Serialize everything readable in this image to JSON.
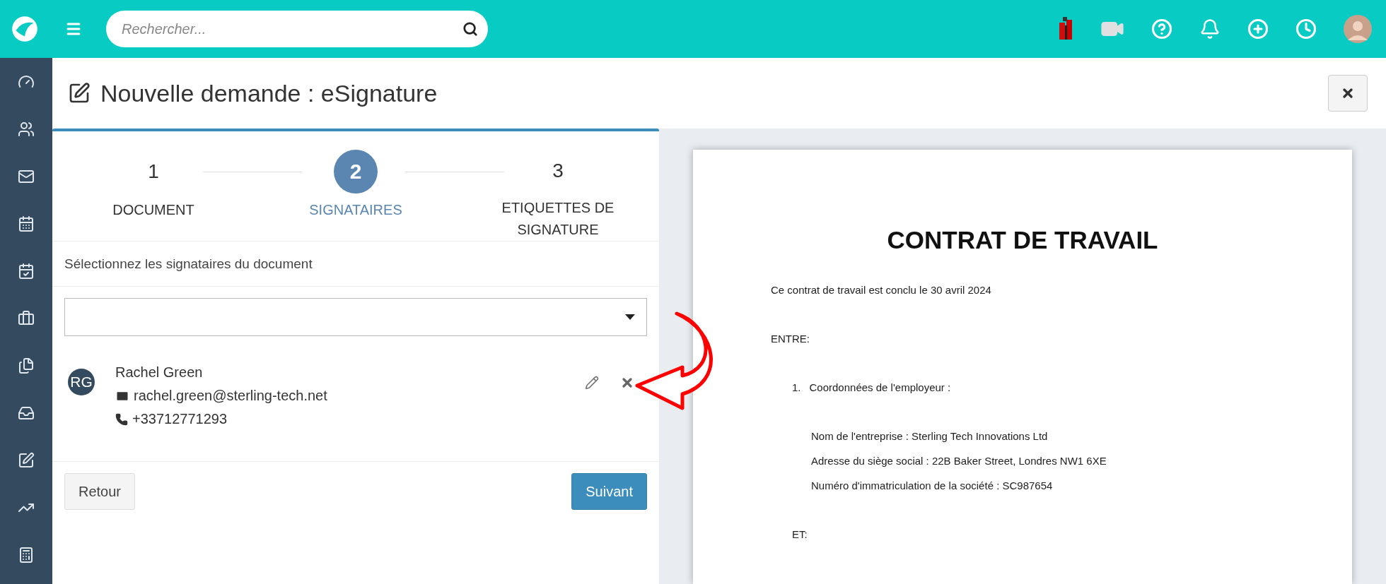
{
  "topbar": {
    "search": {
      "placeholder": "Rechercher..."
    }
  },
  "page": {
    "title": "Nouvelle demande : eSignature"
  },
  "steps": [
    {
      "number": "1",
      "label": "DOCUMENT",
      "selected": false
    },
    {
      "number": "2",
      "label": "SIGNATAIRES",
      "selected": true
    },
    {
      "number": "3",
      "label": "ETIQUETTES DE SIGNATURE",
      "selected": false
    }
  ],
  "instruction": "Sélectionnez les signataires du document",
  "signers": [
    {
      "initials": "RG",
      "name": "Rachel Green",
      "email": "rachel.green@sterling-tech.net",
      "phone": "+33712771293"
    }
  ],
  "buttons": {
    "back": "Retour",
    "next": "Suivant"
  },
  "document": {
    "title": "CONTRAT DE TRAVAIL",
    "lines": [
      {
        "kind": "paragraph",
        "text": "Ce contrat de travail est conclu le 30 avril 2024"
      },
      {
        "kind": "paragraph",
        "text": "ENTRE:"
      },
      {
        "kind": "list_item",
        "number": "1.",
        "text": "Coordonnées de l'employeur :"
      },
      {
        "kind": "detail",
        "text": "Nom de l'entreprise : Sterling Tech Innovations Ltd"
      },
      {
        "kind": "detail",
        "text": "Adresse du siège social : 22B Baker Street, Londres NW1 6XE"
      },
      {
        "kind": "detail",
        "text": "Numéro d'immatriculation de la société : SC987654"
      },
      {
        "kind": "section",
        "text": "ET:"
      }
    ]
  }
}
